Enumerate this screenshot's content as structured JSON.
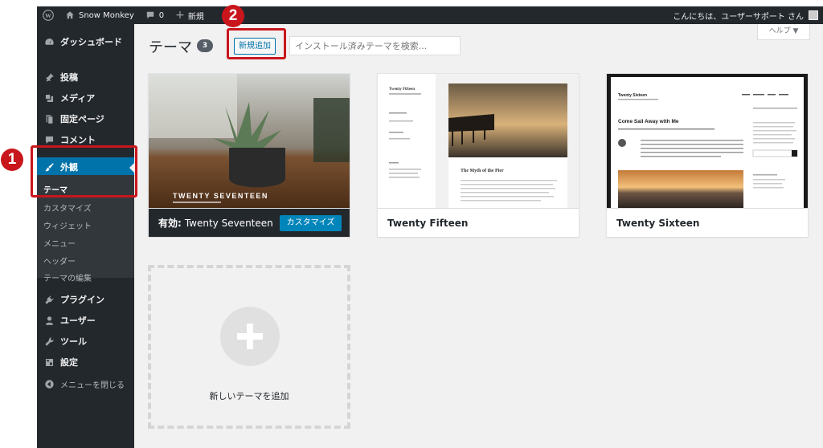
{
  "adminbar": {
    "site_name": "Snow Monkey",
    "comment_count": "0",
    "new_label": "新規",
    "greeting": "こんにちは、ユーザーサポート さん"
  },
  "sidebar": {
    "items": [
      {
        "label": "ダッシュボード",
        "icon": "dashboard-icon"
      },
      {
        "label": "投稿",
        "icon": "pin-icon"
      },
      {
        "label": "メディア",
        "icon": "media-icon"
      },
      {
        "label": "固定ページ",
        "icon": "page-icon"
      },
      {
        "label": "コメント",
        "icon": "comment-icon"
      },
      {
        "label": "外観",
        "icon": "paintbrush-icon"
      },
      {
        "label": "プラグイン",
        "icon": "plugin-icon"
      },
      {
        "label": "ユーザー",
        "icon": "user-icon"
      },
      {
        "label": "ツール",
        "icon": "wrench-icon"
      },
      {
        "label": "設定",
        "icon": "settings-icon"
      },
      {
        "label": "メニューを閉じる",
        "icon": "collapse-icon"
      }
    ],
    "submenu": [
      "テーマ",
      "カスタマイズ",
      "ウィジェット",
      "メニュー",
      "ヘッダー",
      "テーマの編集"
    ]
  },
  "header": {
    "title": "テーマ",
    "count": "3",
    "add_new": "新規追加",
    "search_placeholder": "インストール済みテーマを検索...",
    "help": "ヘルプ ▼"
  },
  "themes": [
    {
      "name": "Twenty Seventeen",
      "active_label": "有効:",
      "customize": "カスタマイズ",
      "screenshot_text": "TWENTY SEVENTEEN"
    },
    {
      "name": "Twenty Fifteen",
      "screenshot_title": "Twenty Fifteen",
      "screenshot_post": "The Myth of the Pier"
    },
    {
      "name": "Twenty Sixteen",
      "screenshot_title": "Twenty Sixteen",
      "screenshot_post": "Come Sail Away with Me"
    }
  ],
  "add_theme_label": "新しいテーマを追加",
  "callouts": [
    "1",
    "2"
  ],
  "colors": {
    "adminbar": "#23282d",
    "accent": "#0073aa",
    "callout": "#c9161c"
  }
}
